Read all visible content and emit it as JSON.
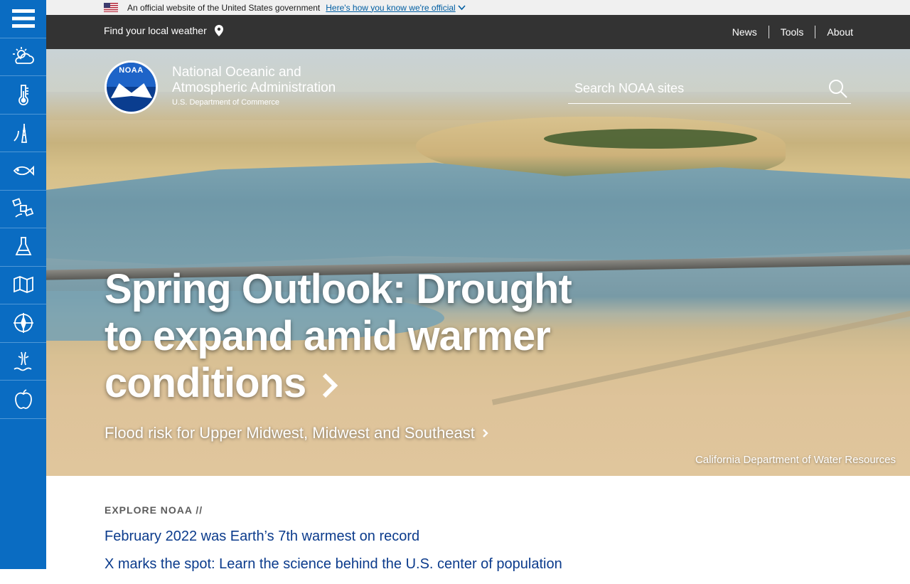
{
  "gov_banner": {
    "text": "An official website of the United States government",
    "link": "Here's how you know we're official"
  },
  "utility_bar": {
    "local_weather": "Find your local weather",
    "nav": [
      "News",
      "Tools",
      "About"
    ]
  },
  "rail": {
    "icons": [
      "menu-icon",
      "weather-icon",
      "climate-icon",
      "coast-icon",
      "fish-icon",
      "satellite-icon",
      "research-icon",
      "charting-icon",
      "navigation-icon",
      "ocean-icon",
      "education-icon"
    ]
  },
  "header": {
    "seal_text": "NOAA",
    "agency_line1": "National Oceanic and",
    "agency_line2": "Atmospheric Administration",
    "department": "U.S. Department of Commerce"
  },
  "search": {
    "placeholder": "Search NOAA sites"
  },
  "hero": {
    "headline": "Spring Outlook: Drought to expand amid warmer conditions",
    "subhead": "Flood risk for Upper Midwest, Midwest and Southeast",
    "credit": "California Department of Water Resources"
  },
  "explore": {
    "label": "EXPLORE NOAA //",
    "links": [
      "February 2022 was Earth’s 7th warmest on record",
      "X marks the spot: Learn the science behind the U.S. center of population"
    ]
  },
  "colors": {
    "rail": "#0a6cc2",
    "utility_bar": "#333333",
    "link": "#0b3b8c",
    "gov_link": "#005ea2"
  }
}
